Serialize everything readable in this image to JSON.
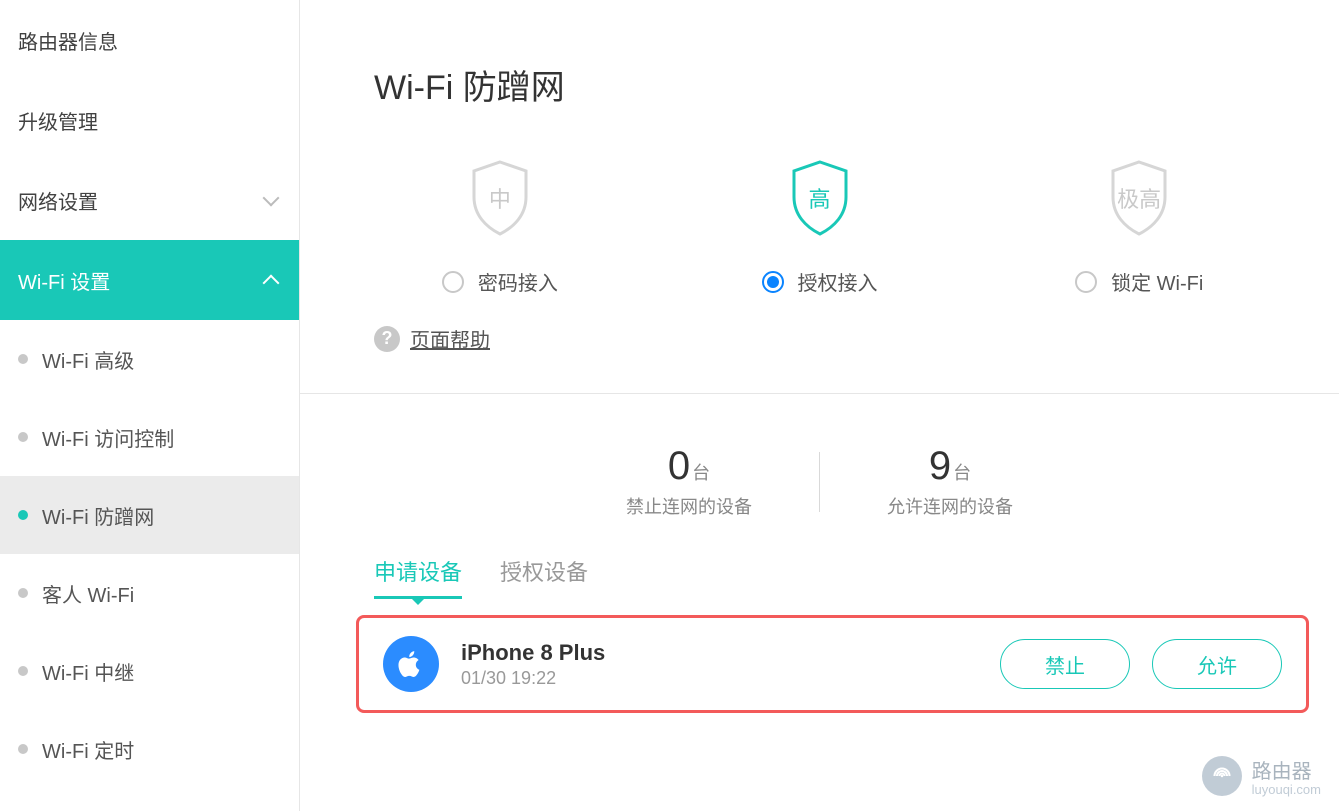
{
  "sidebar": {
    "items": [
      {
        "label": "路由器信息",
        "expandable": false
      },
      {
        "label": "升级管理",
        "expandable": false
      },
      {
        "label": "网络设置",
        "expandable": true,
        "expanded": false
      },
      {
        "label": "Wi-Fi 设置",
        "expandable": true,
        "expanded": true
      }
    ],
    "subitems": [
      {
        "label": "Wi-Fi 高级"
      },
      {
        "label": "Wi-Fi 访问控制"
      },
      {
        "label": "Wi-Fi 防蹭网",
        "selected": true
      },
      {
        "label": "客人 Wi-Fi"
      },
      {
        "label": "Wi-Fi 中继"
      },
      {
        "label": "Wi-Fi 定时"
      }
    ]
  },
  "page": {
    "title": "Wi-Fi 防蹭网",
    "help_label": "页面帮助"
  },
  "modes": [
    {
      "shield_text": "中",
      "radio_label": "密码接入",
      "selected": false
    },
    {
      "shield_text": "高",
      "radio_label": "授权接入",
      "selected": true
    },
    {
      "shield_text": "极高",
      "radio_label": "锁定 Wi-Fi",
      "selected": false
    }
  ],
  "stats": {
    "blocked": {
      "count": "0",
      "unit": "台",
      "label": "禁止连网的设备"
    },
    "allowed": {
      "count": "9",
      "unit": "台",
      "label": "允许连网的设备"
    }
  },
  "tabs": [
    {
      "label": "申请设备",
      "active": true
    },
    {
      "label": "授权设备",
      "active": false
    }
  ],
  "device": {
    "name": "iPhone 8 Plus",
    "timestamp": "01/30 19:22",
    "deny_label": "禁止",
    "allow_label": "允许"
  },
  "brand": {
    "name": "路由器",
    "sub": "luyouqi.com"
  },
  "colors": {
    "accent": "#19c8b7",
    "radio_on": "#0a84ff",
    "highlight": "#f35a5a"
  }
}
